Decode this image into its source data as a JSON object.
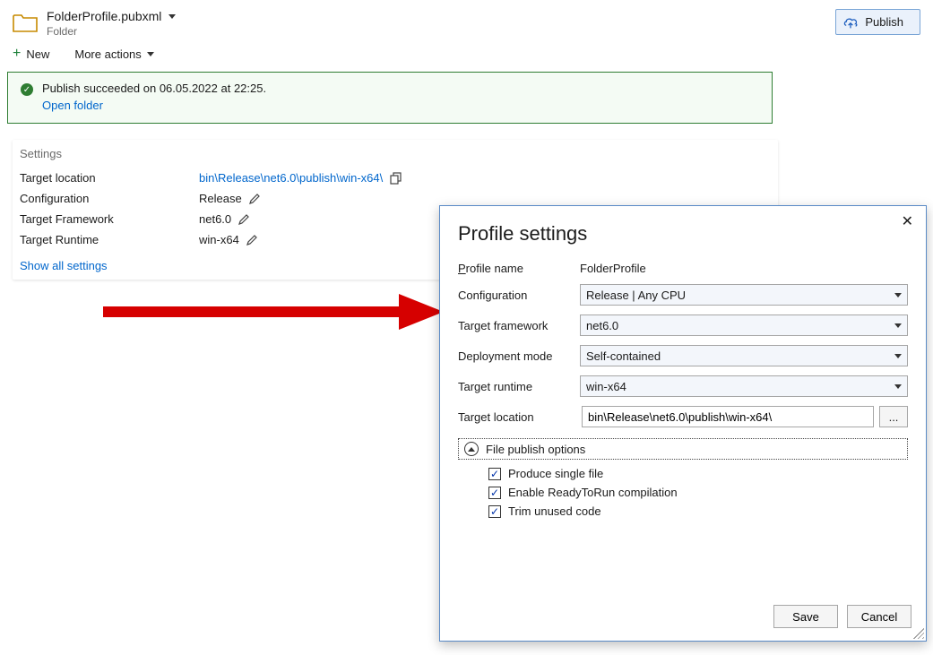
{
  "header": {
    "profile_file": "FolderProfile.pubxml",
    "profile_type": "Folder",
    "publish_label": "Publish"
  },
  "toolbar": {
    "new_label": "New",
    "more_actions_label": "More actions"
  },
  "notice": {
    "message": "Publish succeeded on 06.05.2022 at 22:25.",
    "link_label": "Open folder"
  },
  "settings": {
    "title": "Settings",
    "labels": {
      "target_location": "Target location",
      "configuration": "Configuration",
      "target_framework": "Target Framework",
      "target_runtime": "Target Runtime"
    },
    "values": {
      "target_location": "bin\\Release\\net6.0\\publish\\win-x64\\",
      "configuration": "Release",
      "target_framework": "net6.0",
      "target_runtime": "win-x64"
    },
    "show_all_label": "Show all settings"
  },
  "dialog": {
    "title": "Profile settings",
    "labels": {
      "profile_name": "Profile name",
      "configuration": "Configuration",
      "target_framework": "Target framework",
      "deployment_mode": "Deployment mode",
      "target_runtime": "Target runtime",
      "target_location": "Target location",
      "file_publish_options": "File publish options",
      "browse": "..."
    },
    "values": {
      "profile_name": "FolderProfile",
      "configuration": "Release | Any CPU",
      "target_framework": "net6.0",
      "deployment_mode": "Self-contained",
      "target_runtime": "win-x64",
      "target_location": "bin\\Release\\net6.0\\publish\\win-x64\\"
    },
    "checks": {
      "produce_single_file": "Produce single file",
      "ready_to_run": "Enable ReadyToRun compilation",
      "trim_unused": "Trim unused code"
    },
    "buttons": {
      "save": "Save",
      "cancel": "Cancel"
    }
  }
}
